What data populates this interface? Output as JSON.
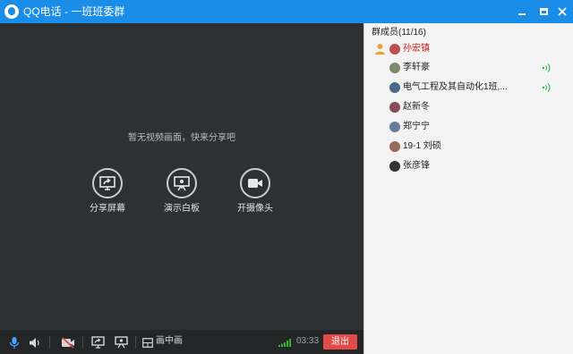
{
  "window": {
    "app_name": "QQ电话",
    "title": "一班班委群",
    "title_full": "QQ电话 - 一班班委群"
  },
  "video": {
    "empty_message": "暂无视频画面，快来分享吧",
    "actions": [
      {
        "icon": "share-screen-icon",
        "label": "分享屏幕"
      },
      {
        "icon": "whiteboard-icon",
        "label": "演示白板"
      },
      {
        "icon": "camera-icon",
        "label": "开摄像头"
      }
    ]
  },
  "toolbar": {
    "layout_label": "画中画",
    "timer": "03:33",
    "exit_label": "退出"
  },
  "members": {
    "header": "群成员(11/16)",
    "list": [
      {
        "name": "孙宏镇",
        "host": true,
        "speaking": false,
        "avatar_color": "#c0504d"
      },
      {
        "name": "李轩豪",
        "host": false,
        "speaking": true,
        "avatar_color": "#7a8b6d"
      },
      {
        "name": "电气工程及其自动化1班,...",
        "host": false,
        "speaking": true,
        "avatar_color": "#4a6a8a"
      },
      {
        "name": "赵新冬",
        "host": false,
        "speaking": false,
        "avatar_color": "#8a4a5a"
      },
      {
        "name": "郑宁宁",
        "host": false,
        "speaking": false,
        "avatar_color": "#6a7a9a"
      },
      {
        "name": "19-1 刘硕",
        "host": false,
        "speaking": false,
        "avatar_color": "#9a6a5a"
      },
      {
        "name": "张彦锋",
        "host": false,
        "speaking": false,
        "avatar_color": "#333333"
      }
    ]
  },
  "colors": {
    "titlebar": "#1a8de8",
    "video_bg": "#2e3133",
    "exit": "#e24a4a",
    "host_name": "#d11b1b",
    "voice_active": "#31b33c"
  }
}
